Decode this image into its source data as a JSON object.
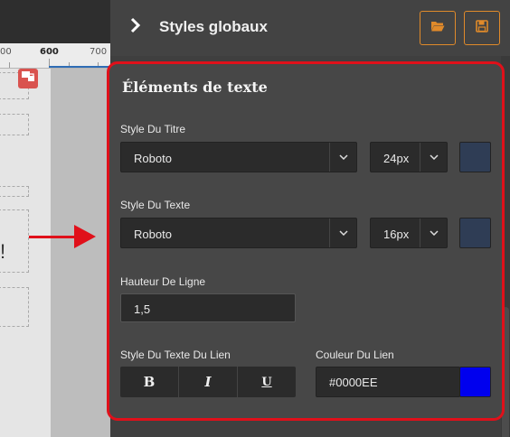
{
  "ruler": {
    "labels": [
      "00",
      "600",
      "700"
    ]
  },
  "panel": {
    "title": "Styles globaux",
    "open_icon": "folder-open-icon",
    "save_icon": "floppy-save-icon"
  },
  "section": {
    "title": "Éléments de texte",
    "title_style": {
      "label": "Style Du Titre",
      "font": "Roboto",
      "size": "24px",
      "color": "#2f3d55"
    },
    "text_style": {
      "label": "Style Du Texte",
      "font": "Roboto",
      "size": "16px",
      "color": "#2f3d55"
    },
    "line_height": {
      "label": "Hauteur De Ligne",
      "value": "1,5"
    },
    "link_style": {
      "label": "Style Du Texte Du Lien",
      "bold": "B",
      "italic": "I",
      "underline": "U"
    },
    "link_color": {
      "label": "Couleur Du Lien",
      "value": "#0000EE",
      "color": "#0000ee"
    }
  },
  "colors": {
    "accent": "#e08a2a",
    "highlight": "#e0101a"
  }
}
